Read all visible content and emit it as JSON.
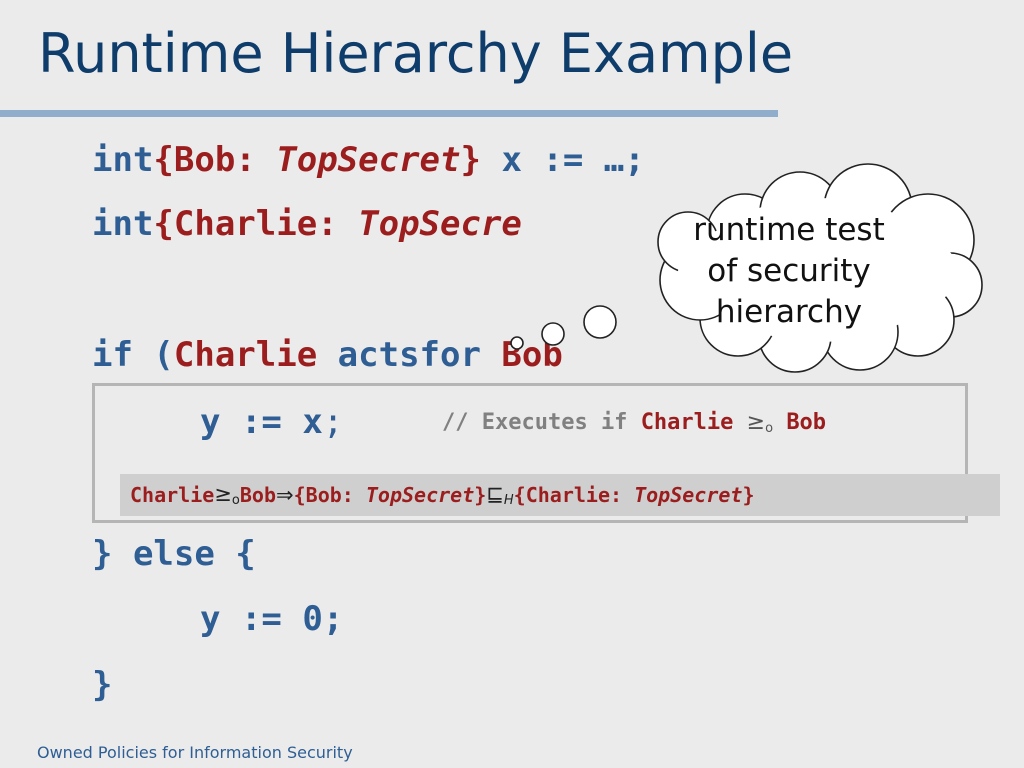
{
  "slide": {
    "title": "Runtime Hierarchy Example",
    "footer": "Owned Policies for Information Security"
  },
  "code": {
    "line1": {
      "keyword": "int",
      "label": "{Bob: ",
      "level": "TopSecret",
      "close": "}",
      "rest": " x := …;"
    },
    "line2": {
      "keyword": "int",
      "label": "{Charlie: ",
      "level": "TopSecre"
    },
    "line3": {
      "keyword": "if (",
      "principal_a": "Charlie",
      "op": " actsfor ",
      "principal_b": "Bob"
    },
    "line4": {
      "stmt": "y := x",
      "semi": ";"
    },
    "line5": {
      "text": "} else {"
    },
    "line6": {
      "stmt": "y := 0;"
    },
    "line7": {
      "text": "}"
    }
  },
  "comment": {
    "prefix": "// Executes if ",
    "principal_a": "Charlie",
    "relation": "≥",
    "relation_sub": "o",
    "principal_b": "Bob"
  },
  "implication": {
    "principal_a": "Charlie",
    "relation": "≥",
    "relation_sub": "o",
    "principal_b": "Bob",
    "implies": "⇒",
    "label1_prefix": "{Bob: ",
    "label1_level": "TopSecret",
    "label1_close": "}",
    "flows": "⊑",
    "flows_sub": "H",
    "label2_prefix": "{Charlie: ",
    "label2_level": "TopSecret",
    "label2_close": "}"
  },
  "callout": {
    "line1": "runtime test",
    "line2": "of security",
    "line3": "hierarchy"
  },
  "colors": {
    "title": "#0f3d6b",
    "code_blue": "#2e5e94",
    "code_red": "#9b1d1d",
    "comment_gray": "#808080",
    "background": "#ebebeb",
    "rule": "#90aecb"
  }
}
